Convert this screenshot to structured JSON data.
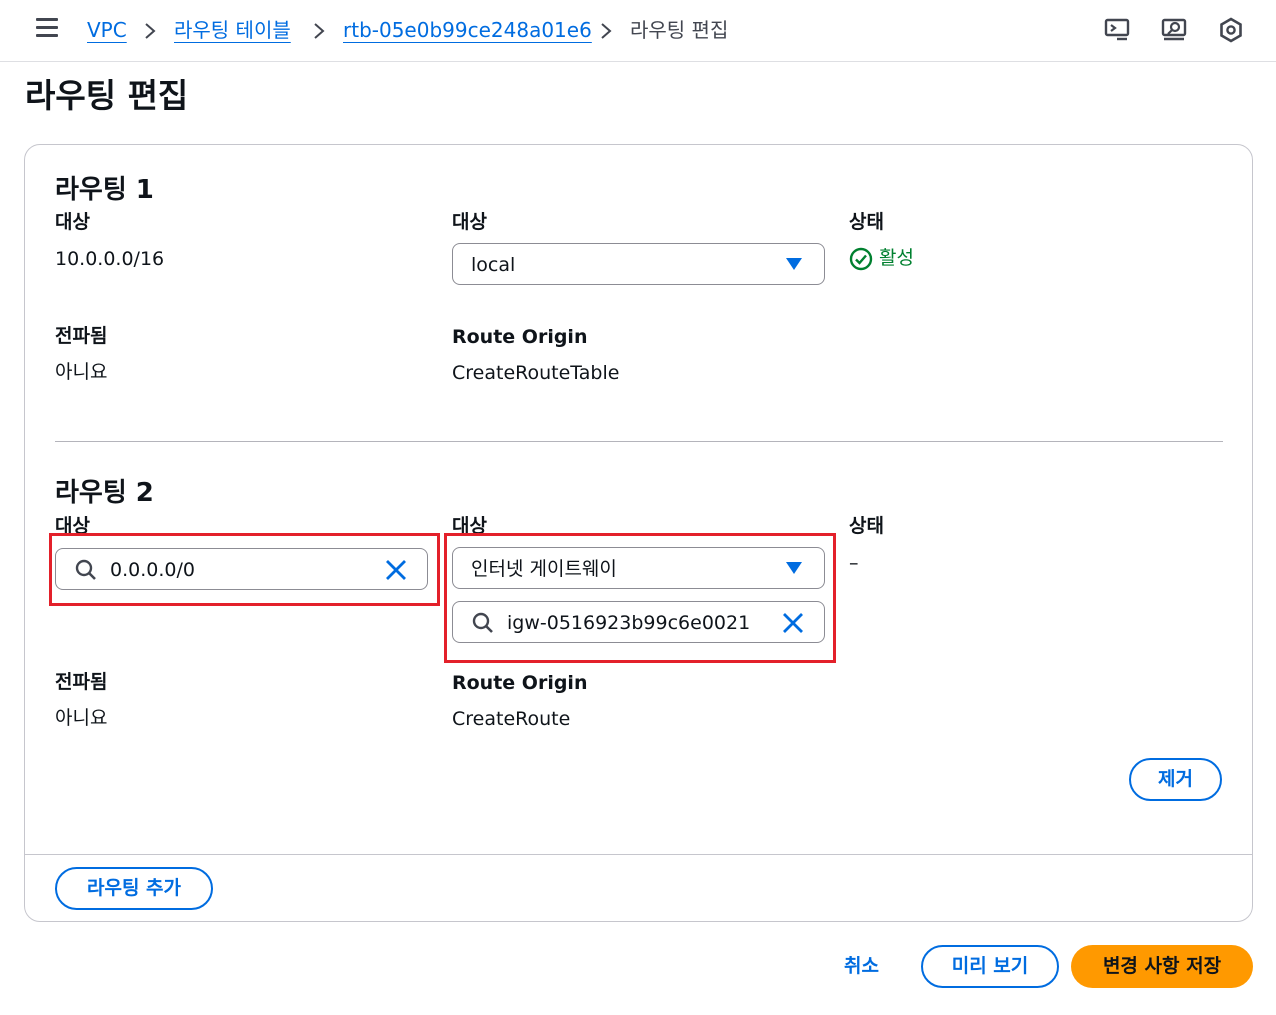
{
  "breadcrumb": {
    "items": [
      "VPC",
      "라우팅 테이블",
      "rtb-05e0b99ce248a01e6"
    ],
    "current": "라우팅 편집"
  },
  "page": {
    "title": "라우팅 편집"
  },
  "routes": [
    {
      "title": "라우팅 1",
      "destination_label": "대상",
      "destination_value": "10.0.0.0/16",
      "target_label": "대상",
      "target_value": "local",
      "status_label": "상태",
      "status_value": "활성",
      "propagated_label": "전파됨",
      "propagated_value": "아니요",
      "origin_label": "Route Origin",
      "origin_value": "CreateRouteTable"
    },
    {
      "title": "라우팅 2",
      "destination_label": "대상",
      "destination_value": "0.0.0.0/0",
      "target_label": "대상",
      "target_value": "인터넷 게이트웨이",
      "target_id_value": "igw-0516923b99c6e0021",
      "status_label": "상태",
      "status_value": "–",
      "propagated_label": "전파됨",
      "propagated_value": "아니요",
      "origin_label": "Route Origin",
      "origin_value": "CreateRoute",
      "remove_label": "제거"
    }
  ],
  "actions": {
    "add_route": "라우팅 추가",
    "cancel": "취소",
    "preview": "미리 보기",
    "save": "변경 사항 저장"
  },
  "colors": {
    "link": "#006ce0",
    "primary": "#ff9900",
    "success": "#00802f",
    "highlight": "#e3202a"
  },
  "icons": [
    "menu-icon",
    "chevron-right-icon",
    "caret-down-icon",
    "search-icon",
    "close-icon",
    "check-circle-icon",
    "cloudshell-icon",
    "notifications-icon",
    "settings-icon"
  ]
}
